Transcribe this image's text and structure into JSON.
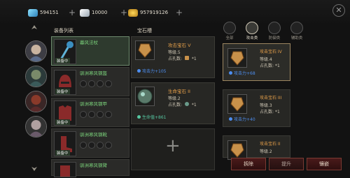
{
  "currency": {
    "blue_gem": {
      "value": "594151",
      "icon": "blue-gem-icon"
    },
    "silver_gem": {
      "value": "10000",
      "icon": "silver-gem-icon"
    },
    "gold": {
      "value": "957919126",
      "icon": "gold-coins-icon"
    }
  },
  "sections": {
    "equip_list": "装备列表",
    "gem_slots": "宝石槽"
  },
  "equipment": [
    {
      "name": "暮风法杖",
      "badge": "装备中"
    },
    {
      "name": "驯洲寒风钢盔",
      "badge": "装备中"
    },
    {
      "name": "驯洲寒风钢甲",
      "badge": "装备中"
    },
    {
      "name": "驯洲寒风钢靴",
      "badge": "装备中"
    },
    {
      "name": "驯洲寒风钢臂"
    }
  ],
  "gem_slots": [
    {
      "name": "攻击宝石 V",
      "level": "等级.5",
      "holes_label": "占孔数:",
      "holes": "*1",
      "stat": "攻击力+105"
    },
    {
      "name": "生命宝石 II",
      "level": "等级.2",
      "holes_label": "占孔数:",
      "holes": "*1",
      "stat": "生命值+861"
    }
  ],
  "tabs": [
    {
      "label": "全部"
    },
    {
      "label": "攻击类"
    },
    {
      "label": "防御类"
    },
    {
      "label": "辅助类"
    }
  ],
  "inventory": [
    {
      "name": "攻击宝石 IV",
      "level": "等级.4",
      "holes_label": "占孔数:",
      "holes": "*1",
      "stat": "攻击力+68"
    },
    {
      "name": "攻击宝石 III",
      "level": "等级.3",
      "holes_label": "占孔数:",
      "holes": "*1",
      "stat": "攻击力+40"
    },
    {
      "name": "攻击宝石 II",
      "level": "等级.2",
      "holes_label": "",
      "holes": "",
      "stat": ""
    }
  ],
  "buttons": {
    "remove": "拆除",
    "upgrade": "提升",
    "inlay": "镶嵌"
  },
  "colors": {
    "gem_name": "#e7a04a",
    "equip_name": "#7ad07a",
    "stat_blue": "#4d8ef0",
    "stat_green": "#56c7a1",
    "selected_border": "#9c8660"
  }
}
